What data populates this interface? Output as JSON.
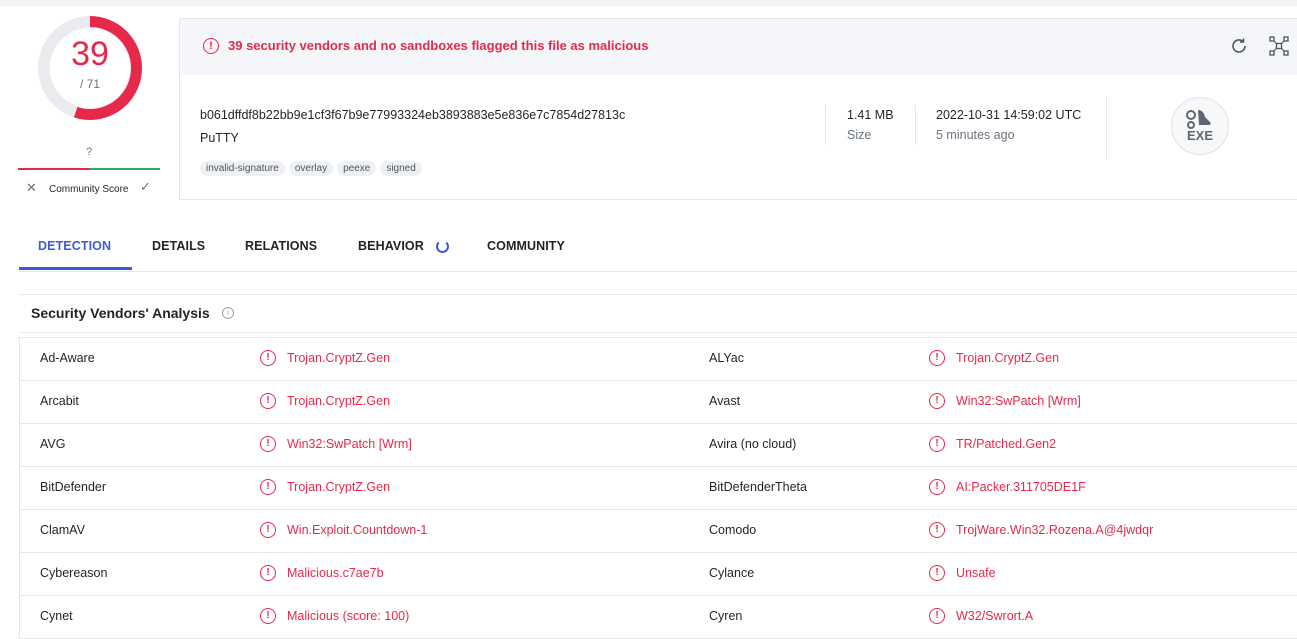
{
  "score": {
    "detections": "39",
    "total": "/ 71",
    "detection_fraction": 0.549,
    "community_unknown": "?",
    "community_label": "Community Score",
    "colors": {
      "malicious": "#e6294b",
      "harmless": "#2fa86a"
    }
  },
  "banner": {
    "text": "39 security vendors and no sandboxes flagged this file as malicious",
    "reanalyze_icon": "reanalyze-icon",
    "graph_icon": "graph-icon"
  },
  "file": {
    "hash": "b061dffdf8b22bb9e1cf3f67b9e77993324eb3893883e5e836e7c7854d27813c",
    "name": "PuTTY",
    "tags": [
      "invalid-signature",
      "overlay",
      "peexe",
      "signed"
    ],
    "size_value": "1.41 MB",
    "size_label": "Size",
    "date_value": "2022-10-31 14:59:02 UTC",
    "date_label": "5 minutes ago",
    "type_badge": "EXE"
  },
  "tabs": [
    {
      "label": "DETECTION",
      "active": true
    },
    {
      "label": "DETAILS",
      "active": false
    },
    {
      "label": "RELATIONS",
      "active": false
    },
    {
      "label": "BEHAVIOR",
      "active": false
    },
    {
      "label": "COMMUNITY",
      "active": false
    }
  ],
  "section": {
    "title": "Security Vendors' Analysis",
    "info_icon": "info-icon"
  },
  "vendors": [
    {
      "left_vendor": "Ad-Aware",
      "left_result": "Trojan.CryptZ.Gen",
      "right_vendor": "ALYac",
      "right_result": "Trojan.CryptZ.Gen"
    },
    {
      "left_vendor": "Arcabit",
      "left_result": "Trojan.CryptZ.Gen",
      "right_vendor": "Avast",
      "right_result": "Win32:SwPatch [Wrm]"
    },
    {
      "left_vendor": "AVG",
      "left_result": "Win32:SwPatch [Wrm]",
      "right_vendor": "Avira (no cloud)",
      "right_result": "TR/Patched.Gen2"
    },
    {
      "left_vendor": "BitDefender",
      "left_result": "Trojan.CryptZ.Gen",
      "right_vendor": "BitDefenderTheta",
      "right_result": "AI:Packer.311705DE1F"
    },
    {
      "left_vendor": "ClamAV",
      "left_result": "Win.Exploit.Countdown-1",
      "right_vendor": "Comodo",
      "right_result": "TrojWare.Win32.Rozena.A@4jwdqr"
    },
    {
      "left_vendor": "Cybereason",
      "left_result": "Malicious.c7ae7b",
      "right_vendor": "Cylance",
      "right_result": "Unsafe"
    },
    {
      "left_vendor": "Cynet",
      "left_result": "Malicious (score: 100)",
      "right_vendor": "Cyren",
      "right_result": "W32/Swrort.A"
    }
  ]
}
